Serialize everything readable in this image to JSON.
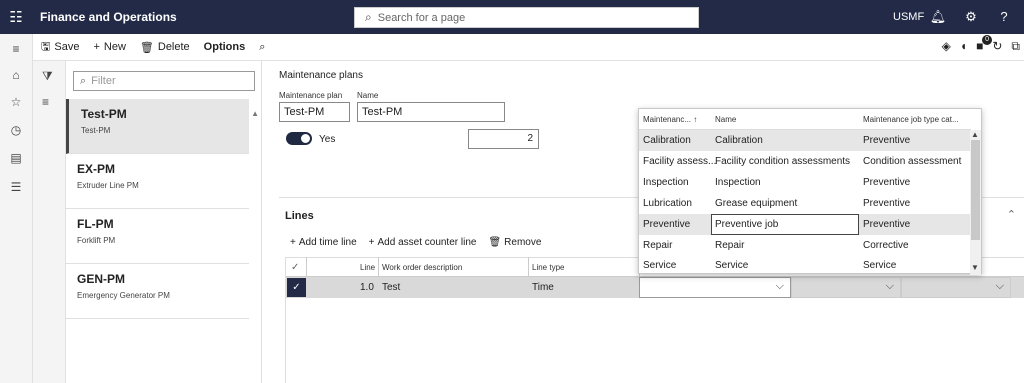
{
  "topbar": {
    "app_title": "Finance and Operations",
    "search_placeholder": "Search for a page",
    "company": "USMF",
    "help": "?"
  },
  "actions": {
    "save": "Save",
    "new": "New",
    "delete": "Delete",
    "options": "Options",
    "notification_count": "0"
  },
  "list": {
    "filter_placeholder": "Filter",
    "items": [
      {
        "title": "Test-PM",
        "subtitle": "Test-PM"
      },
      {
        "title": "EX-PM",
        "subtitle": "Extruder Line PM"
      },
      {
        "title": "FL-PM",
        "subtitle": "Forklift PM"
      },
      {
        "title": "GEN-PM",
        "subtitle": "Emergency Generator PM"
      }
    ]
  },
  "detail": {
    "section_title": "Maintenance plans",
    "plan_label": "Maintenance plan",
    "plan_value": "Test-PM",
    "name_label": "Name",
    "name_value": "Test-PM",
    "toggle_text": "Yes",
    "number_value": "2"
  },
  "lines": {
    "title": "Lines",
    "add_time_line": "Add time line",
    "add_asset_counter_line": "Add asset counter line",
    "remove": "Remove",
    "columns": [
      "Line",
      "Work order description",
      "Line type"
    ],
    "row": {
      "line": "1.0",
      "description": "Test",
      "line_type": "Time"
    }
  },
  "lookup": {
    "columns": [
      "Maintenanc...",
      "Name",
      "Maintenance job type cat..."
    ],
    "rows": [
      {
        "code": "Calibration",
        "name": "Calibration",
        "category": "Preventive"
      },
      {
        "code": "Facility assess...",
        "name": "Facility condition assessments",
        "category": "Condition assessment"
      },
      {
        "code": "Inspection",
        "name": "Inspection",
        "category": "Preventive"
      },
      {
        "code": "Lubrication",
        "name": "Grease equipment",
        "category": "Preventive"
      },
      {
        "code": "Preventive",
        "name": "Preventive job",
        "category": "Preventive"
      },
      {
        "code": "Repair",
        "name": "Repair",
        "category": "Corrective"
      },
      {
        "code": "Service",
        "name": "Service",
        "category": "Service"
      }
    ]
  },
  "colors": {
    "topbar": "#222a47",
    "accent": "#1f2942"
  }
}
